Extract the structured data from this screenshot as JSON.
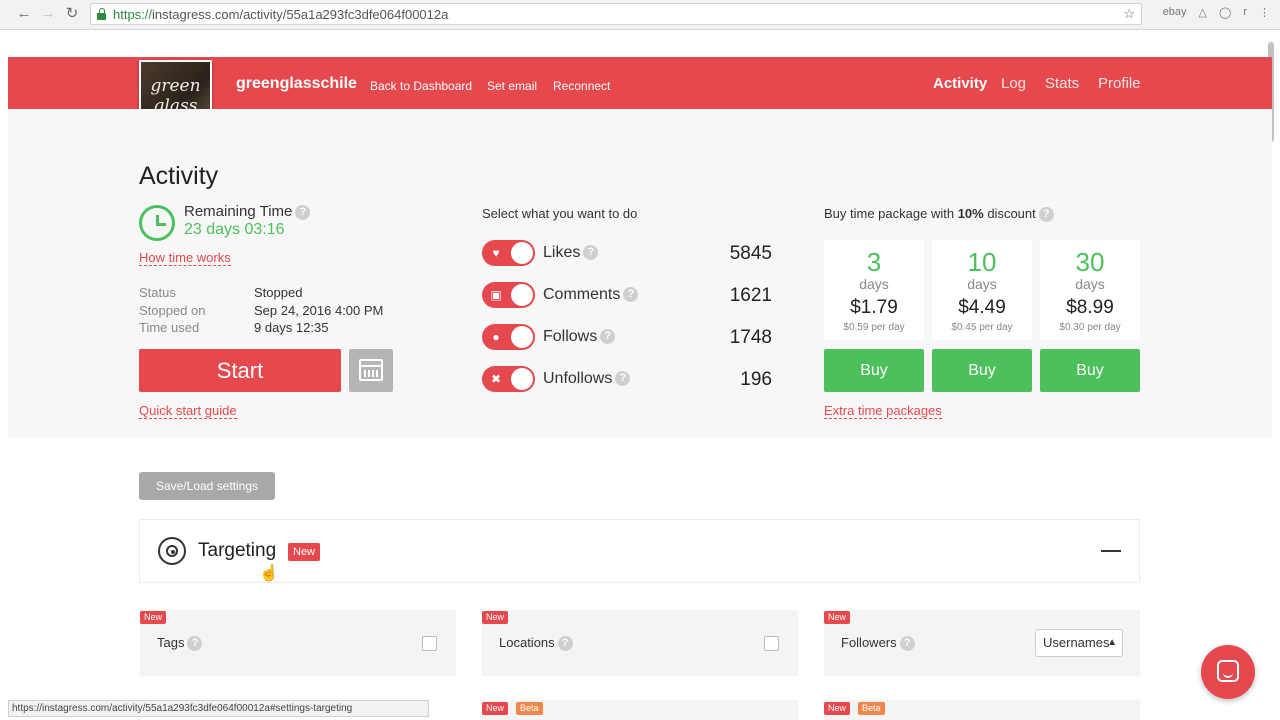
{
  "browser": {
    "back_icon": "arrow-left",
    "forward_icon": "arrow-right",
    "reload_icon": "reload",
    "url_scheme": "https://",
    "url_rest": "instagress.com/activity/55a1a293fc3dfe064f00012a",
    "status_url": "https://instagress.com/activity/55a1a293fc3dfe064f00012a#settings-targeting"
  },
  "header": {
    "logo_text": "green glass",
    "username": "greenglasschile",
    "links": [
      "Back to Dashboard",
      "Set email",
      "Reconnect"
    ],
    "nav": [
      "Activity",
      "Log",
      "Stats",
      "Profile"
    ],
    "active_nav": "Activity",
    "accent_color": "#e5484d"
  },
  "activity": {
    "title": "Activity",
    "remaining_label": "Remaining Time",
    "remaining_value": "23 days 03:16",
    "how_time_works": "How time works",
    "status_rows": [
      {
        "key": "Status",
        "value": "Stopped"
      },
      {
        "key": "Stopped on",
        "value": "Sep 24, 2016 4:00 PM"
      },
      {
        "key": "Time used",
        "value": "9 days 12:35"
      }
    ],
    "start_label": "Start",
    "quick_start": "Quick start guide"
  },
  "actions": {
    "select_label": "Select what you want to do",
    "items": [
      {
        "label": "Likes",
        "count": "5845",
        "icon": "heart-icon"
      },
      {
        "label": "Comments",
        "count": "1621",
        "icon": "comment-icon"
      },
      {
        "label": "Follows",
        "count": "1748",
        "icon": "user-icon"
      },
      {
        "label": "Unfollows",
        "count": "196",
        "icon": "x-icon"
      }
    ]
  },
  "packages": {
    "label_pre": "Buy time package with ",
    "label_bold": "10%",
    "label_post": " discount",
    "items": [
      {
        "num": "3",
        "unit": "days",
        "price": "$1.79",
        "per": "$0.59 per day",
        "buy": "Buy"
      },
      {
        "num": "10",
        "unit": "days",
        "price": "$4.49",
        "per": "$0.45 per day",
        "buy": "Buy"
      },
      {
        "num": "30",
        "unit": "days",
        "price": "$8.99",
        "per": "$0.30 per day",
        "buy": "Buy"
      }
    ],
    "extra": "Extra time packages",
    "buy_color": "#4cc15b"
  },
  "settings": {
    "save_load": "Save/Load settings",
    "targeting_title": "Targeting",
    "new_badge": "New",
    "beta_badge": "Beta",
    "cards": [
      {
        "label": "Tags"
      },
      {
        "label": "Locations"
      },
      {
        "label": "Followers",
        "select": "Usernames"
      }
    ]
  }
}
